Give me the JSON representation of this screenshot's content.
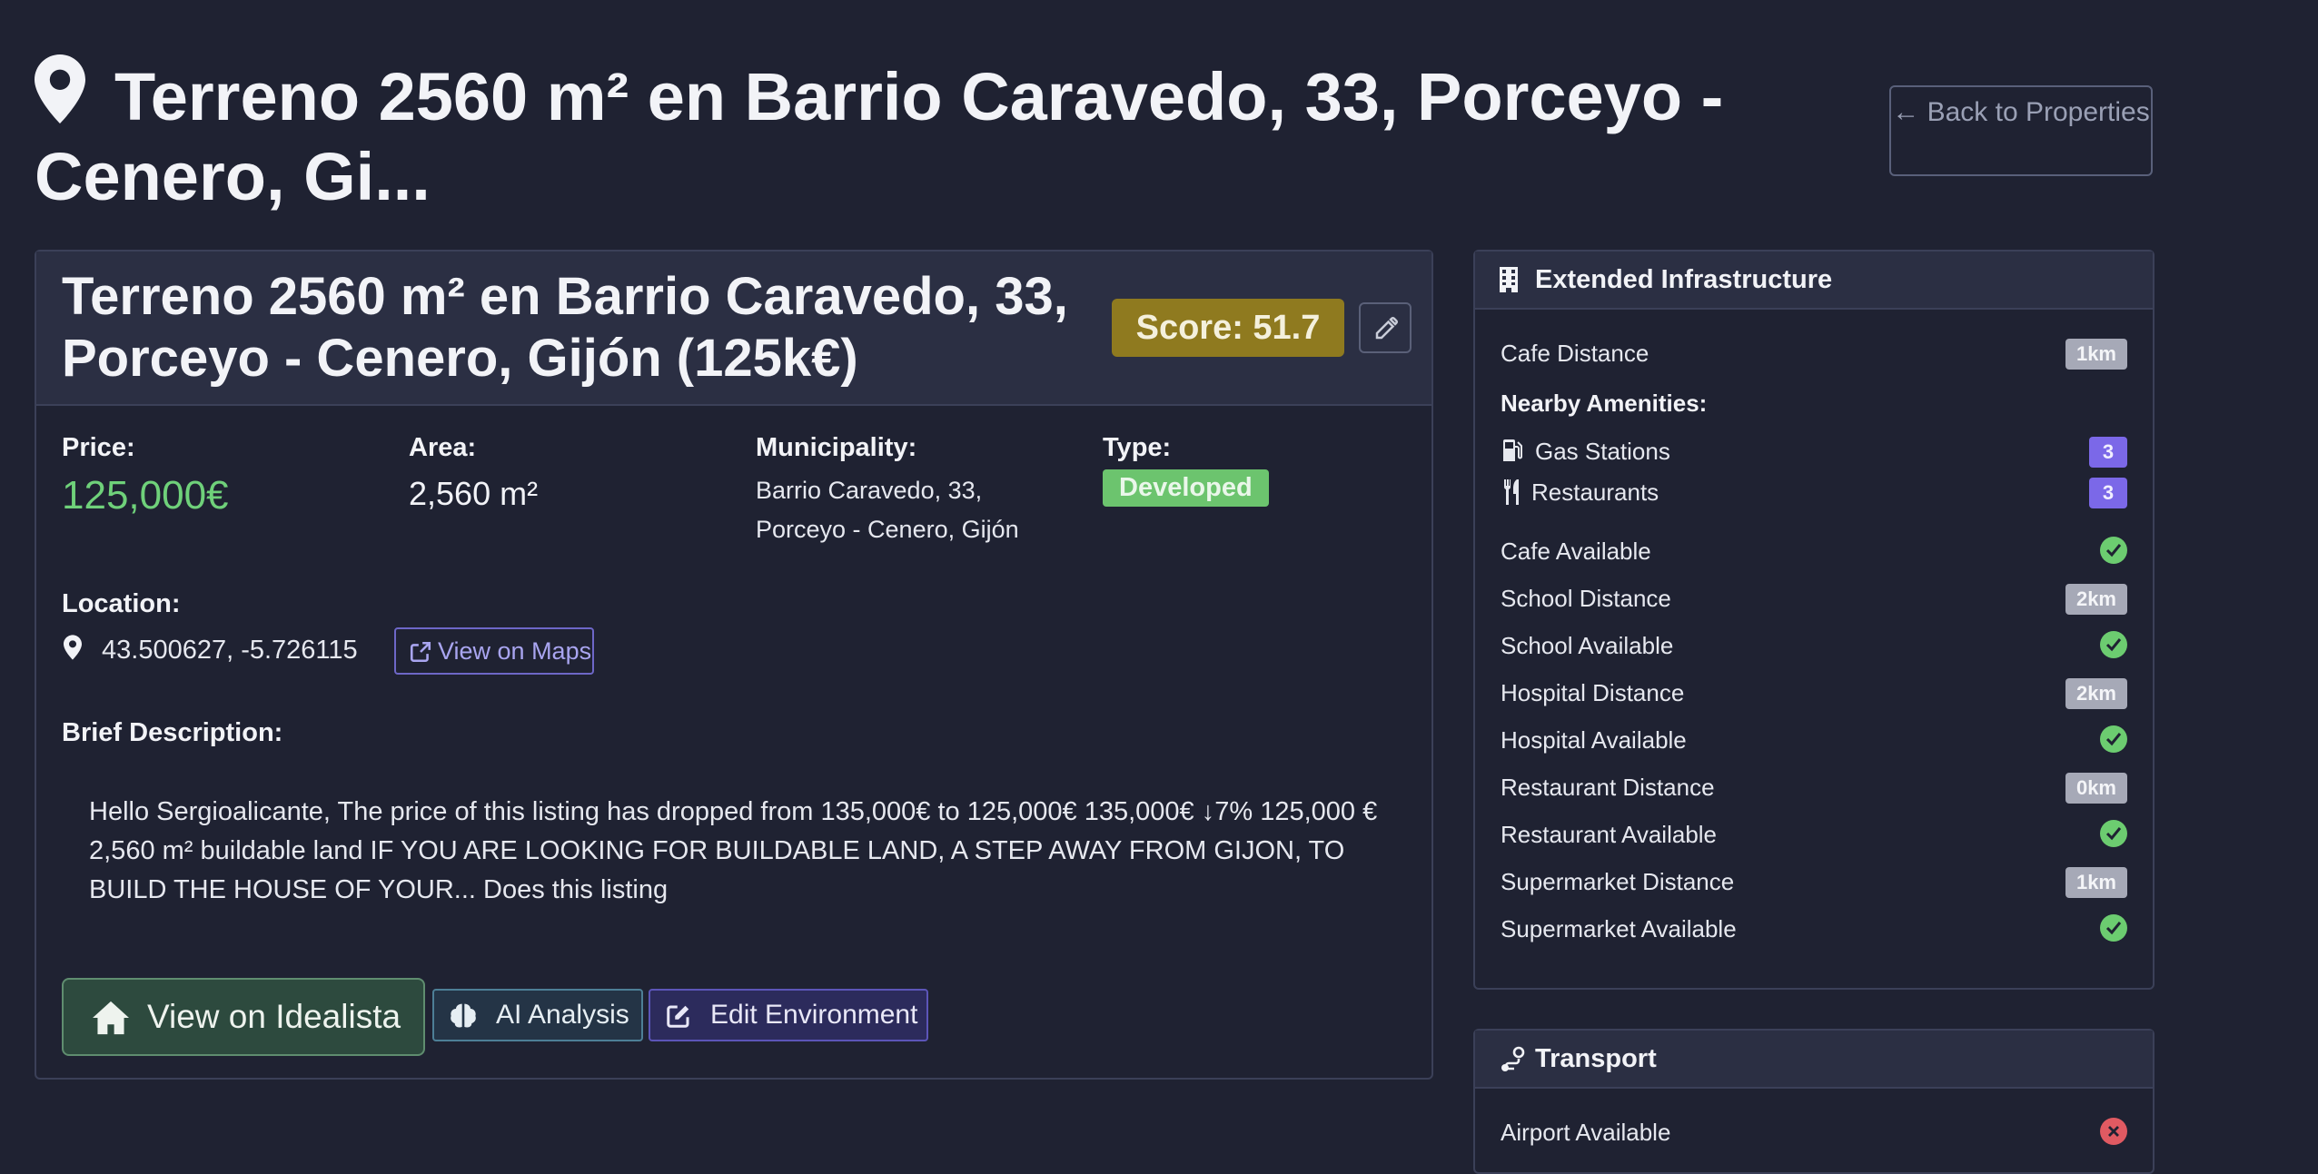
{
  "header": {
    "title": "Terreno 2560 m² en Barrio Caravedo, 33, Porceyo - Cenero, Gi...",
    "back_label": "← Back to Properties"
  },
  "card": {
    "title": "Terreno 2560 m² en Barrio Caravedo, 33, Porceyo - Cenero, Gijón (125k€)",
    "score": "Score: 51.7",
    "price_label": "Price:",
    "price": "125,000€",
    "area_label": "Area:",
    "area": "2,560 m²",
    "municipality_label": "Municipality:",
    "municipality": "Barrio Caravedo, 33, Porceyo - Cenero, Gijón",
    "type_label": "Type:",
    "type": "Developed",
    "location_label": "Location:",
    "coordinates": "43.500627, -5.726115",
    "maps_label": "View on Maps",
    "description_label": "Brief Description:",
    "description": "Hello Sergioalicante, The price of this listing has dropped from 135,000€ to 125,000€ 135,000€ ↓7% 125,000 € 2,560 m² buildable land IF YOU ARE LOOKING FOR BUILDABLE LAND, A STEP AWAY FROM GIJON, TO BUILD THE HOUSE OF YOUR... Does this listing",
    "btn_idealista": "View on Idealista",
    "btn_ai": "AI Analysis",
    "btn_env": "Edit Environment"
  },
  "infrastructure": {
    "title": "Extended Infrastructure",
    "cafe_distance_label": "Cafe Distance",
    "cafe_distance": "1km",
    "nearby_label": "Nearby Amenities:",
    "gas_label": "Gas Stations",
    "gas_count": "3",
    "restaurants_label": "Restaurants",
    "restaurants_count": "3",
    "cafe_available_label": "Cafe Available",
    "school_distance_label": "School Distance",
    "school_distance": "2km",
    "school_available_label": "School Available",
    "hospital_distance_label": "Hospital Distance",
    "hospital_distance": "2km",
    "hospital_available_label": "Hospital Available",
    "restaurant_distance_label": "Restaurant Distance",
    "restaurant_distance": "0km",
    "restaurant_available_label": "Restaurant Available",
    "supermarket_distance_label": "Supermarket Distance",
    "supermarket_distance": "1km",
    "supermarket_available_label": "Supermarket Available"
  },
  "transport": {
    "title": "Transport",
    "airport_available_label": "Airport Available"
  },
  "colors": {
    "background": "#1f2232",
    "price": "#6fd17a",
    "score_badge": "#8f7a1f",
    "type_badge": "#6cc46e",
    "available": "#6ccc70",
    "unavailable": "#e05a62",
    "count_badge": "#7b68e8"
  }
}
